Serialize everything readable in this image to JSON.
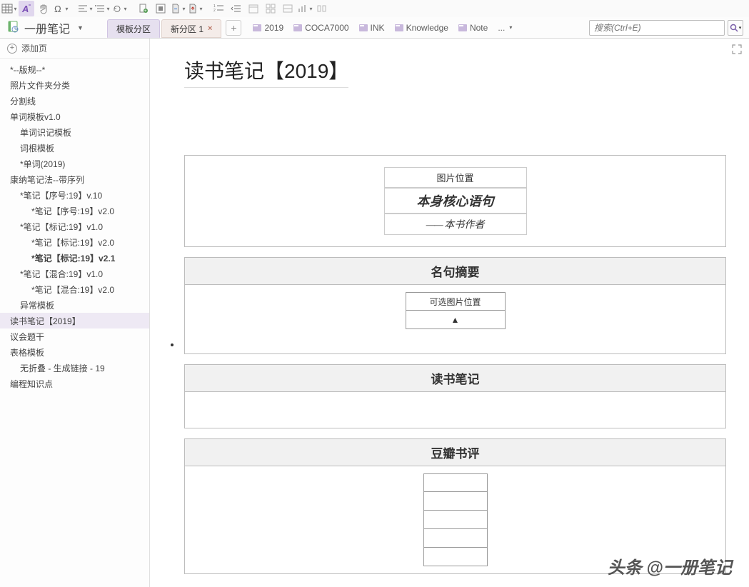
{
  "notebook": {
    "title": "一册笔记"
  },
  "tabs": [
    {
      "label": "模板分区",
      "active": true
    },
    {
      "label": "新分区 1",
      "active": false,
      "closable": true
    }
  ],
  "section_links": [
    "2019",
    "COCA7000",
    "INK",
    "Knowledge",
    "Note"
  ],
  "more_label": "...",
  "search": {
    "placeholder": "搜索(Ctrl+E)"
  },
  "add_page_label": "添加页",
  "pages": [
    {
      "label": "*--版规--*",
      "level": 0
    },
    {
      "label": "照片文件夹分类",
      "level": 0
    },
    {
      "label": "分割线",
      "level": 0
    },
    {
      "label": "单词模板v1.0",
      "level": 0
    },
    {
      "label": "单词识记模板",
      "level": 1
    },
    {
      "label": "词根模板",
      "level": 1
    },
    {
      "label": "*单词(2019)",
      "level": 1
    },
    {
      "label": "康纳笔记法--带序列",
      "level": 0
    },
    {
      "label": "*笔记【序号:19】v.10",
      "level": 1
    },
    {
      "label": "*笔记【序号:19】v2.0",
      "level": 2
    },
    {
      "label": "*笔记【标记:19】v1.0",
      "level": 1
    },
    {
      "label": "*笔记【标记:19】v2.0",
      "level": 2
    },
    {
      "label": "*笔记【标记:19】v2.1",
      "level": 2,
      "bold": true
    },
    {
      "label": "*笔记【混合:19】v1.0",
      "level": 1
    },
    {
      "label": "*笔记【混合:19】v2.0",
      "level": 2
    },
    {
      "label": "异常模板",
      "level": 1
    },
    {
      "label": "读书笔记【2019】",
      "level": 0,
      "selected": true
    },
    {
      "label": "议会题干",
      "level": 0
    },
    {
      "label": "表格模板",
      "level": 0
    },
    {
      "label": "无折叠 - 生成链接 - 19",
      "level": 1
    },
    {
      "label": "编程知识点",
      "level": 0
    }
  ],
  "page_title": "读书笔记【2019】",
  "header_cells": {
    "image_pos": "图片位置",
    "core_sentence": "本身核心语句",
    "author": "本书作者"
  },
  "sections": {
    "quotes": {
      "title": "名句摘要",
      "cell1": "可选图片位置",
      "cell2": "▲"
    },
    "notes": {
      "title": "读书笔记"
    },
    "reviews": {
      "title": "豆瓣书评"
    }
  },
  "watermark": {
    "prefix": "头条 ",
    "at": "@",
    "name": "一册笔记"
  }
}
